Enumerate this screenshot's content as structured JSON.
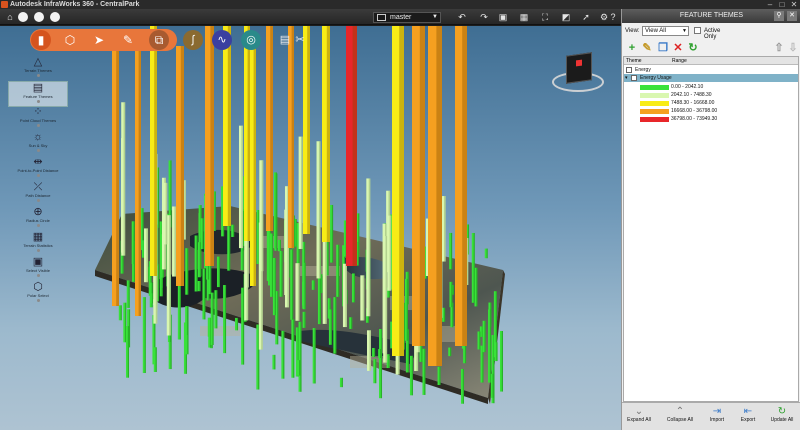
{
  "window": {
    "title": "Autodesk InfraWorks 360 - CentralPark",
    "minimize": "–",
    "maximize": "□",
    "close": "✕"
  },
  "toolbar": {
    "proposal_value": "master",
    "icons": [
      "undo-icon",
      "redo-icon",
      "save-icon",
      "capture-icon",
      "fullscreen-icon",
      "screenshot-icon",
      "pointer-icon",
      "settings-icon",
      "help-icon"
    ]
  },
  "panel": {
    "title": "FEATURE THEMES",
    "view_label": "View:",
    "view_value": "View All",
    "active_only_label": "Active Only",
    "columns": [
      "Theme",
      "Range"
    ],
    "tree": [
      {
        "label": "Energy",
        "level": 0
      },
      {
        "label": "Energy Usage",
        "level": 1,
        "selected": true
      }
    ],
    "ranges": [
      {
        "text": "0.00 - 2042.10",
        "color": "#39e23a"
      },
      {
        "text": "2042.10 - 7488.30",
        "color": "#d9f7b0"
      },
      {
        "text": "7488.30 - 16668.00",
        "color": "#f8ec16"
      },
      {
        "text": "16668.00 - 36798.00",
        "color": "#f5a020"
      },
      {
        "text": "36798.00 - 73949.30",
        "color": "#e8262a"
      }
    ],
    "footer": {
      "expand_all": "Expand All",
      "collapse_all": "Collapse All",
      "import": "Import",
      "export": "Export",
      "update_all": "Update All"
    }
  },
  "tools": [
    {
      "label": "Terrain Themes"
    },
    {
      "label": "Feature Themes",
      "active": true
    },
    {
      "label": "Point Cloud Themes"
    },
    {
      "label": "Sun & Sky"
    },
    {
      "label": "Point-to-Point Distance"
    },
    {
      "label": "Path Distance"
    },
    {
      "label": "Radius Circle"
    },
    {
      "label": "Terrain Statistics"
    },
    {
      "label": "Select Visible"
    },
    {
      "label": "Polar Select"
    }
  ],
  "colors": {
    "accent": "#e8763b",
    "low": "#39e23a",
    "low_mid": "#d9f7b0",
    "mid": "#f8ec16",
    "high": "#f5a020",
    "very_high": "#e8262a"
  }
}
